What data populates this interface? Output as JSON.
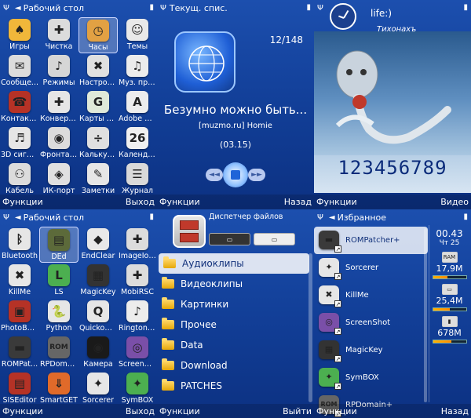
{
  "status": {
    "ant": "Ψ",
    "batt": "▮",
    "arrow": "◄"
  },
  "panel1": {
    "title": "Рабочий стол",
    "icons": [
      {
        "label": "Игры",
        "name": "games-icon",
        "bg": "#f0b73a",
        "glyph": "♠"
      },
      {
        "label": "Чистка",
        "name": "cleaner-icon",
        "bg": "#dcdcdc",
        "glyph": "✚"
      },
      {
        "label": "Часы",
        "name": "clock-icon",
        "bg": "#e2a143",
        "glyph": "◷",
        "sel": true
      },
      {
        "label": "Темы",
        "name": "themes-icon",
        "bg": "#e9e9e9",
        "glyph": "☺"
      },
      {
        "label": "Сообще...",
        "name": "messages-icon",
        "bg": "#dcdcdc",
        "glyph": "✉"
      },
      {
        "label": "Режимы",
        "name": "profiles-icon",
        "bg": "#d6d6d6",
        "glyph": "♪"
      },
      {
        "label": "Настройки",
        "name": "settings-icon",
        "bg": "#e0e0e0",
        "glyph": "✖"
      },
      {
        "label": "Муз. про...",
        "name": "music-icon",
        "bg": "#ececec",
        "glyph": "♫"
      },
      {
        "label": "Контакты",
        "name": "contacts-icon",
        "bg": "#b53226",
        "glyph": "☎"
      },
      {
        "label": "Конвертер",
        "name": "converter-icon",
        "bg": "#e6e6e6",
        "glyph": "✚"
      },
      {
        "label": "Карты G...",
        "name": "maps-icon",
        "bg": "#dfe9d9",
        "glyph": "G"
      },
      {
        "label": "Adobe Re...",
        "name": "adobe-icon",
        "bg": "#ededed",
        "glyph": "A"
      },
      {
        "label": "3D сигн...",
        "name": "sound-icon",
        "bg": "#e6e6e6",
        "glyph": "♬"
      },
      {
        "label": "Фронтал...",
        "name": "camera-icon",
        "bg": "#dcdcdc",
        "glyph": "◉"
      },
      {
        "label": "Калькуля...",
        "name": "calculator-icon",
        "bg": "#e0e0e0",
        "glyph": "÷"
      },
      {
        "label": "Календарь",
        "name": "calendar-icon",
        "bg": "#f0f0f0",
        "glyph": "26"
      },
      {
        "label": "Кабель",
        "name": "cable-icon",
        "bg": "#dcdcdc",
        "glyph": "⚇"
      },
      {
        "label": "ИК-порт",
        "name": "infrared-icon",
        "bg": "#e0e0e0",
        "glyph": "◈"
      },
      {
        "label": "Заметки",
        "name": "notes-icon",
        "bg": "#e6e6e6",
        "glyph": "✎"
      },
      {
        "label": "Журнал",
        "name": "log-icon",
        "bg": "#d9d9d9",
        "glyph": "☰"
      }
    ],
    "left_soft": "Функции",
    "right_soft": "Выход"
  },
  "panel2": {
    "title": "Текущ. спис.",
    "track": "12/148",
    "song": "Безумно можно быть...",
    "artist": "[muzmo.ru] Homie",
    "time": "(03.15)",
    "left_soft": "Функции",
    "right_soft": "Назад"
  },
  "panel3": {
    "user": "life:)",
    "deco": "Тихонахъ",
    "digits": "123456789",
    "left_soft": "Функции",
    "right_soft": "Видео"
  },
  "panel4": {
    "title": "Рабочий стол",
    "icons": [
      {
        "label": "Bluetooth",
        "name": "bluetooth-icon",
        "bg": "#e6e6e6",
        "glyph": "ᛒ"
      },
      {
        "label": "DEd",
        "name": "ded-icon",
        "bg": "#5c6a3a",
        "glyph": "▤",
        "sel": true
      },
      {
        "label": "EndClear",
        "name": "endclear-icon",
        "bg": "#e8e8e8",
        "glyph": "◆"
      },
      {
        "label": "ImageIon...",
        "name": "imageion-icon",
        "bg": "#dcdcdc",
        "glyph": "✚"
      },
      {
        "label": "KillMe",
        "name": "killme-icon",
        "bg": "#e6e6e6",
        "glyph": "✖"
      },
      {
        "label": "LS",
        "name": "ls-icon",
        "bg": "#4caf50",
        "glyph": "L"
      },
      {
        "label": "MagicKey",
        "name": "magickey-icon",
        "bg": "#333333",
        "glyph": "▦"
      },
      {
        "label": "MobiRSC",
        "name": "mobirsc-icon",
        "bg": "#dcdcdc",
        "glyph": "✚"
      },
      {
        "label": "PhotoBo...",
        "name": "photobox-icon",
        "bg": "#b53226",
        "glyph": "▣"
      },
      {
        "label": "Python",
        "name": "python-icon",
        "bg": "#e6e6e6",
        "glyph": "🐍"
      },
      {
        "label": "Quickoffice",
        "name": "quickoffice-icon",
        "bg": "#e6e6e6",
        "glyph": "Q"
      },
      {
        "label": "Ringtone...",
        "name": "ringtone-icon",
        "bg": "#ececec",
        "glyph": "♪"
      },
      {
        "label": "ROMPat...",
        "name": "rompatcher-icon",
        "bg": "#3a3a3a",
        "glyph": "▬"
      },
      {
        "label": "RPDomain+",
        "name": "rpdomain-icon",
        "bg": "#666666",
        "glyph": "ROM"
      },
      {
        "label": "Камера",
        "name": "camera2-icon",
        "bg": "#1a1a1a",
        "glyph": "◉"
      },
      {
        "label": "ScreenShot",
        "name": "screenshot-icon",
        "bg": "#7a4fa8",
        "glyph": "◎"
      },
      {
        "label": "SISEditor",
        "name": "siseditor-icon",
        "bg": "#b53226",
        "glyph": "▤"
      },
      {
        "label": "SmartGET",
        "name": "smartget-icon",
        "bg": "#e06a2a",
        "glyph": "⇓"
      },
      {
        "label": "Sorcerer",
        "name": "sorcerer-icon",
        "bg": "#e6e6e6",
        "glyph": "✦"
      },
      {
        "label": "SymBOX",
        "name": "symbox-icon",
        "bg": "#4caf50",
        "glyph": "✦"
      }
    ],
    "left_soft": "Функции",
    "right_soft": "Выход"
  },
  "panel5": {
    "title": "Диспетчер файлов",
    "folders": [
      "Аудиоклипы",
      "Видеоклипы",
      "Картинки",
      "Прочее",
      "Data",
      "Download",
      "PATCHES"
    ],
    "left_soft": "Функции",
    "right_soft": "Выйти"
  },
  "panel6": {
    "title": "Избранное",
    "items": [
      {
        "label": "ROMPatcher+",
        "name": "rompatcher-icon",
        "bg": "#3a3a3a",
        "glyph": "▬",
        "sel": true
      },
      {
        "label": "Sorcerer",
        "name": "sorcerer-icon",
        "bg": "#e6e6e6",
        "glyph": "✦"
      },
      {
        "label": "KillMe",
        "name": "killme-icon",
        "bg": "#e6e6e6",
        "glyph": "✖"
      },
      {
        "label": "ScreenShot",
        "name": "screenshot-icon",
        "bg": "#7a4fa8",
        "glyph": "◎"
      },
      {
        "label": "MagicKey",
        "name": "magickey-icon",
        "bg": "#333333",
        "glyph": "▦"
      },
      {
        "label": "SymBOX",
        "name": "symbox-icon",
        "bg": "#4caf50",
        "glyph": "✦"
      },
      {
        "label": "RPDomain+",
        "name": "rpdomain-icon",
        "bg": "#666666",
        "glyph": "ROM"
      }
    ],
    "clock": "00.43",
    "day": "Чт 25",
    "ram": {
      "label": "RAM",
      "value": "17,9M",
      "fill": 0.45
    },
    "disk1": {
      "value": "25,4M",
      "fill": 0.5
    },
    "disk2": {
      "value": "678M",
      "fill": 0.55
    },
    "left_soft": "Функции",
    "right_soft": "Назад"
  }
}
